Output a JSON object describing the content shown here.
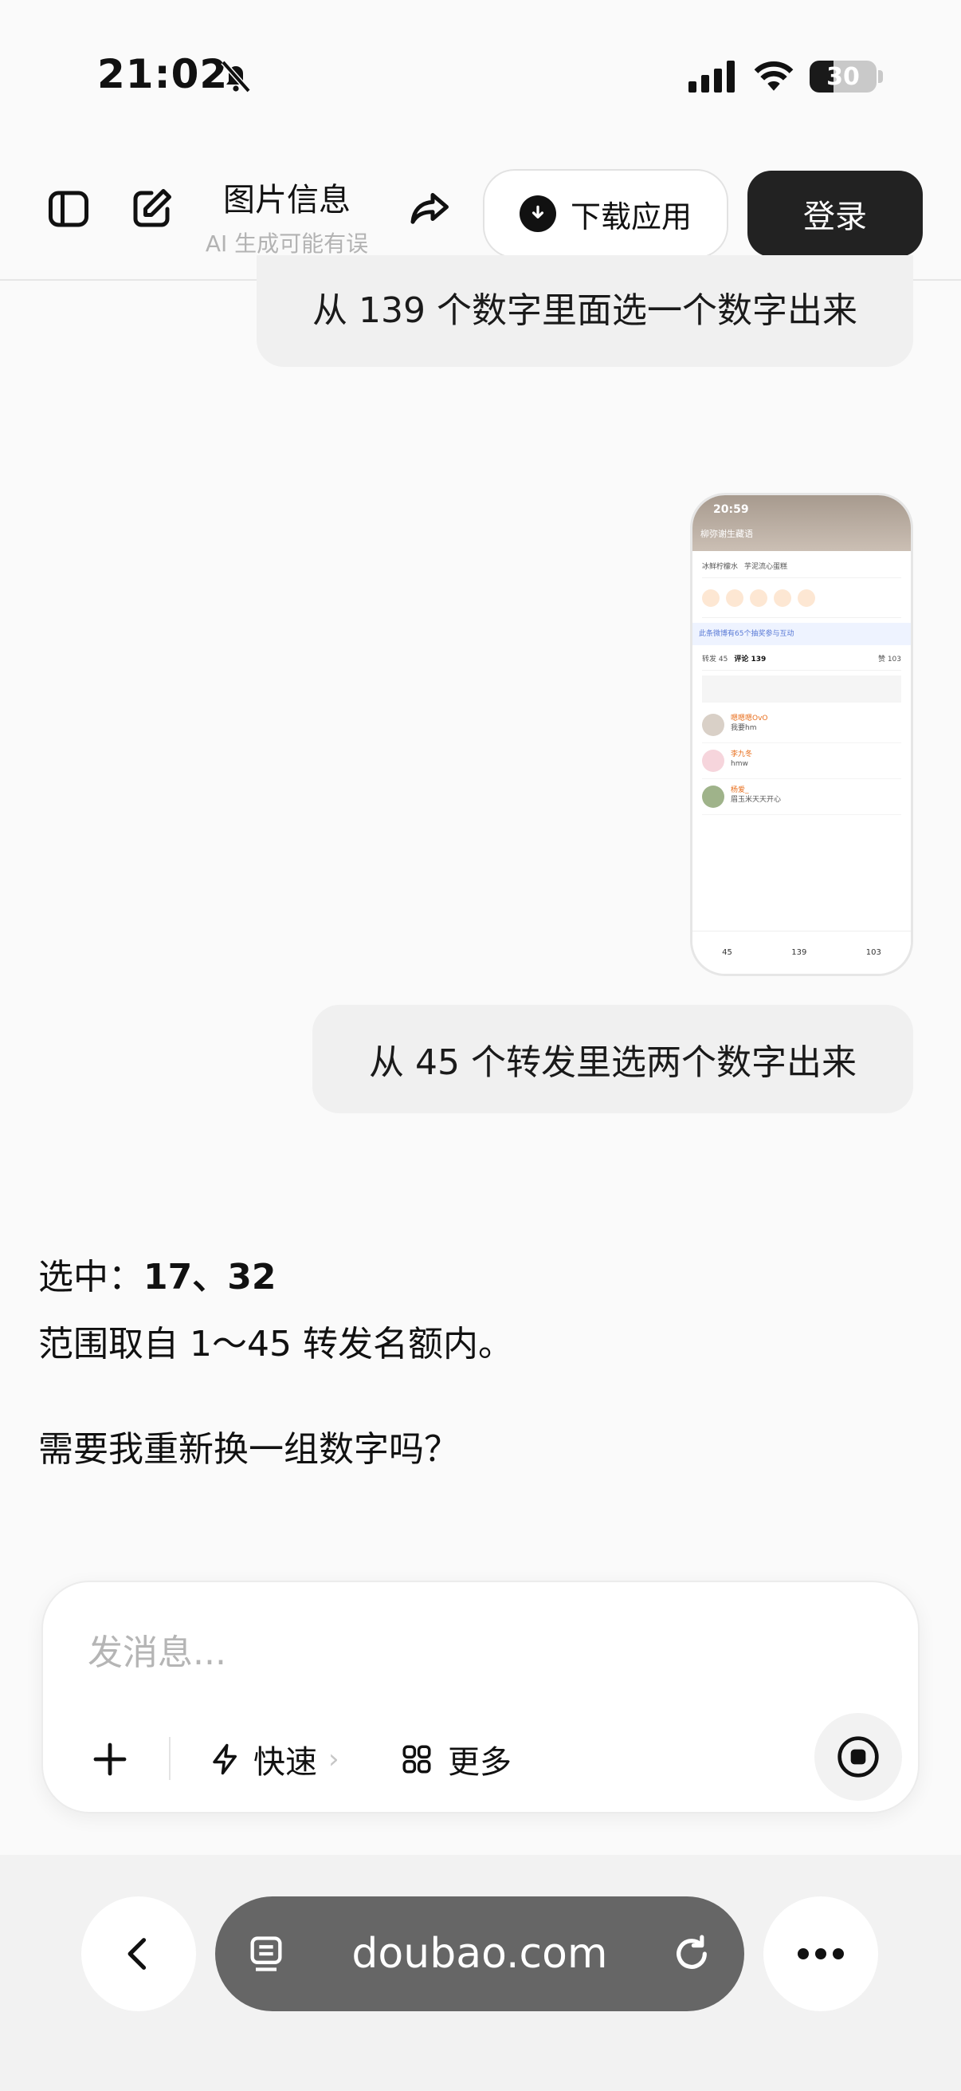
{
  "status_bar": {
    "time": "21:02",
    "battery": "30"
  },
  "header": {
    "title": "图片信息",
    "subtitle": "AI 生成可能有误",
    "download_label": "下载应用",
    "login_label": "登录"
  },
  "messages": {
    "user_1": "从 139 个数字里面选一个数字出来",
    "user_2": "从 45 个转发里选两个数字出来",
    "answer_line1_prefix": "选中：",
    "answer_line1_numbers": "17、32",
    "answer_line2": "范围取自 1～45 转发名额内。",
    "answer_line3": "需要我重新换一组数字吗？"
  },
  "thumbnail": {
    "time": "20:59",
    "nav_title": "柳弥谢生藏语",
    "search_1": "冰鲜柠檬水",
    "search_2": "芋泥流心蛋糕",
    "banner": "此条微博有65个抽奖参与互动",
    "tabs": {
      "repost": "转发 45",
      "comments": "评论 139",
      "likes": "赞 103"
    },
    "comments": [
      {
        "name": "嗯嗯嗯OvO",
        "text": "我要hm"
      },
      {
        "name": "李九冬",
        "text": "hmw"
      },
      {
        "name": "杨爱_",
        "text": "眉玉米天天开心"
      }
    ],
    "footer": {
      "repost": "45",
      "comments": "139",
      "likes": "103"
    }
  },
  "composer": {
    "placeholder": "发消息...",
    "quick_label": "快速",
    "more_label": "更多"
  },
  "browser": {
    "url": "doubao.com"
  }
}
